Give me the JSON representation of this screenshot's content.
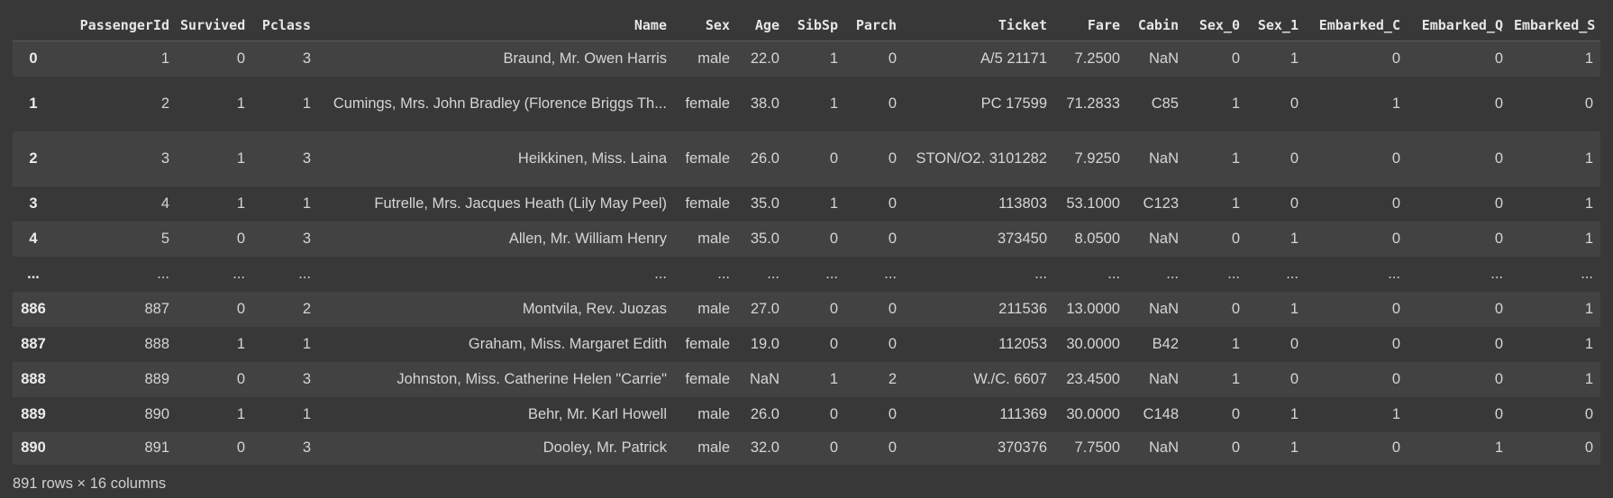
{
  "columns": [
    "",
    "PassengerId",
    "Survived",
    "Pclass",
    "Name",
    "Sex",
    "Age",
    "SibSp",
    "Parch",
    "Ticket",
    "Fare",
    "Cabin",
    "Sex_0",
    "Sex_1",
    "Embarked_C",
    "Embarked_Q",
    "Embarked_S"
  ],
  "rows": [
    [
      "0",
      "1",
      "0",
      "3",
      "Braund, Mr. Owen Harris",
      "male",
      "22.0",
      "1",
      "0",
      "A/5 21171",
      "7.2500",
      "NaN",
      "0",
      "1",
      "0",
      "0",
      "1"
    ],
    [
      "1",
      "2",
      "1",
      "1",
      "Cumings, Mrs. John Bradley (Florence Briggs Th...",
      "female",
      "38.0",
      "1",
      "0",
      "PC 17599",
      "71.2833",
      "C85",
      "1",
      "0",
      "1",
      "0",
      "0"
    ],
    [
      "2",
      "3",
      "1",
      "3",
      "Heikkinen, Miss. Laina",
      "female",
      "26.0",
      "0",
      "0",
      "STON/O2. 3101282",
      "7.9250",
      "NaN",
      "1",
      "0",
      "0",
      "0",
      "1"
    ],
    [
      "3",
      "4",
      "1",
      "1",
      "Futrelle, Mrs. Jacques Heath (Lily May Peel)",
      "female",
      "35.0",
      "1",
      "0",
      "113803",
      "53.1000",
      "C123",
      "1",
      "0",
      "0",
      "0",
      "1"
    ],
    [
      "4",
      "5",
      "0",
      "3",
      "Allen, Mr. William Henry",
      "male",
      "35.0",
      "0",
      "0",
      "373450",
      "8.0500",
      "NaN",
      "0",
      "1",
      "0",
      "0",
      "1"
    ],
    [
      "...",
      "...",
      "...",
      "...",
      "...",
      "...",
      "...",
      "...",
      "...",
      "...",
      "...",
      "...",
      "...",
      "...",
      "...",
      "...",
      "..."
    ],
    [
      "886",
      "887",
      "0",
      "2",
      "Montvila, Rev. Juozas",
      "male",
      "27.0",
      "0",
      "0",
      "211536",
      "13.0000",
      "NaN",
      "0",
      "1",
      "0",
      "0",
      "1"
    ],
    [
      "887",
      "888",
      "1",
      "1",
      "Graham, Miss. Margaret Edith",
      "female",
      "19.0",
      "0",
      "0",
      "112053",
      "30.0000",
      "B42",
      "1",
      "0",
      "0",
      "0",
      "1"
    ],
    [
      "888",
      "889",
      "0",
      "3",
      "Johnston, Miss. Catherine Helen \"Carrie\"",
      "female",
      "NaN",
      "1",
      "2",
      "W./C. 6607",
      "23.4500",
      "NaN",
      "1",
      "0",
      "0",
      "0",
      "1"
    ],
    [
      "889",
      "890",
      "1",
      "1",
      "Behr, Mr. Karl Howell",
      "male",
      "26.0",
      "0",
      "0",
      "111369",
      "30.0000",
      "C148",
      "0",
      "1",
      "1",
      "0",
      "0"
    ],
    [
      "890",
      "891",
      "0",
      "3",
      "Dooley, Mr. Patrick",
      "male",
      "32.0",
      "0",
      "0",
      "370376",
      "7.7500",
      "NaN",
      "0",
      "1",
      "0",
      "1",
      "0"
    ]
  ],
  "shape_text": "891 rows × 16 columns",
  "colors": {
    "background": "#383838",
    "row_stripe": "#424242",
    "text": "#d5d5d5",
    "header_text": "#e6e6e6"
  }
}
